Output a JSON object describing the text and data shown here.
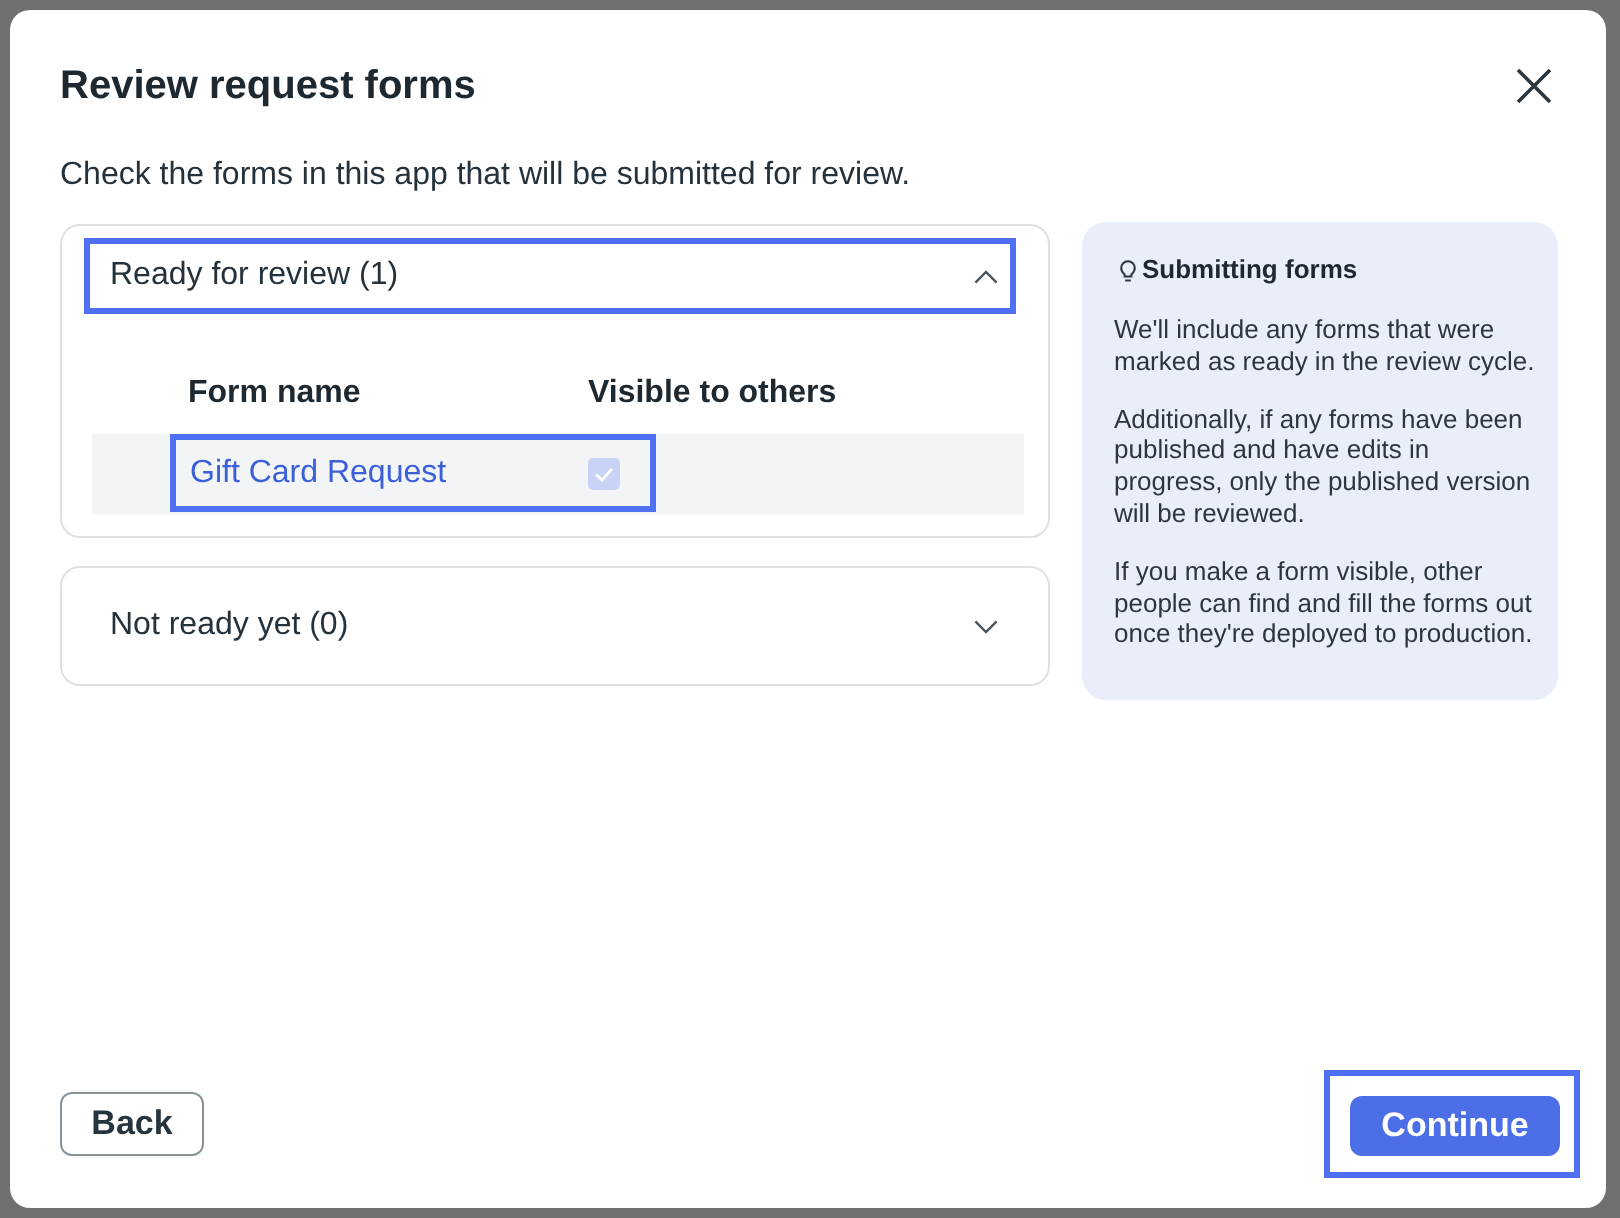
{
  "dialog": {
    "title": "Review request forms",
    "description": "Check the forms in this app that will be submitted for review."
  },
  "sections": [
    {
      "label": "Ready for review (1)",
      "expanded": true,
      "highlighted": true,
      "columns": [
        "Form name",
        "Visible to others"
      ],
      "rows": [
        {
          "form_name": "Gift Card Request",
          "visible": true,
          "disabled": true,
          "highlighted": true
        }
      ]
    },
    {
      "label": "Not ready yet (0)",
      "expanded": false,
      "highlighted": false
    }
  ],
  "info_panel": {
    "title": "Submitting forms",
    "paragraphs": [
      "We'll include any forms that were marked as ready in the review cycle.",
      "Additionally, if any forms have been published and have edits in progress, only the published version will be reviewed.",
      "If you make a form visible, other people can find and fill the forms out once they're deployed to production."
    ]
  },
  "footer_buttons": [
    {
      "label": "Back",
      "kind": "secondary",
      "highlighted": false
    },
    {
      "label": "Continue",
      "kind": "primary",
      "highlighted": true
    }
  ]
}
